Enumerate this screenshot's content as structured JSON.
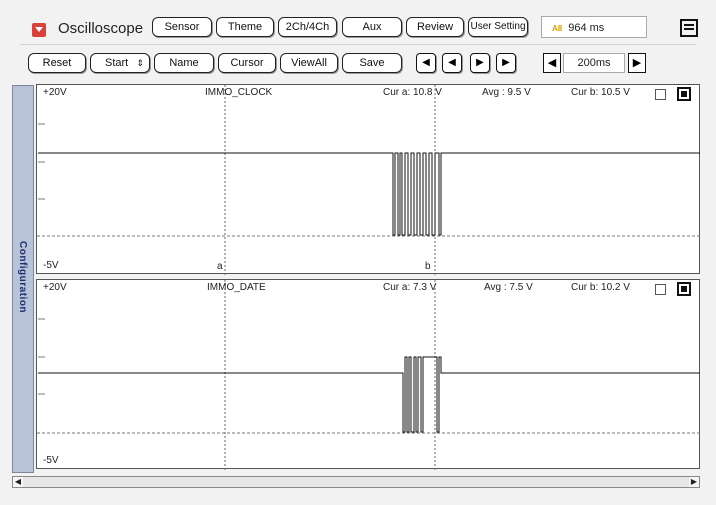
{
  "app": {
    "title": "Oscilloscope",
    "elapsed_label": "964 ms",
    "time_icon_text": "A8"
  },
  "toolbar_top": {
    "buttons": [
      "Sensor",
      "Theme",
      "2Ch/4Ch",
      "Aux",
      "Review",
      "User Setting"
    ]
  },
  "toolbar_second": {
    "reset": "Reset",
    "start": "Start",
    "name": "Name",
    "cursor": "Cursor",
    "viewall": "ViewAll",
    "save": "Save",
    "timebase": "200ms"
  },
  "sidebar": {
    "label": "Configuration"
  },
  "channels": [
    {
      "name": "IMMO_CLOCK",
      "y_top_label": "+20V",
      "y_bottom_label": "-5V",
      "cur_a": "Cur a: 10.8 V",
      "avg": "Avg   : 9.5 V",
      "cur_b": "Cur b: 10.5 V",
      "cursor_a_label": "a",
      "cursor_b_label": "b"
    },
    {
      "name": "IMMO_DATE",
      "y_top_label": "+20V",
      "y_bottom_label": "-5V",
      "cur_a": "Cur a: 7.3 V",
      "avg": "Avg   : 7.5 V",
      "cur_b": "Cur b: 10.2 V"
    }
  ],
  "colors": {
    "sidebar": "#b8c2d8",
    "app_icon": "#d9413a",
    "trace": "#111111"
  }
}
